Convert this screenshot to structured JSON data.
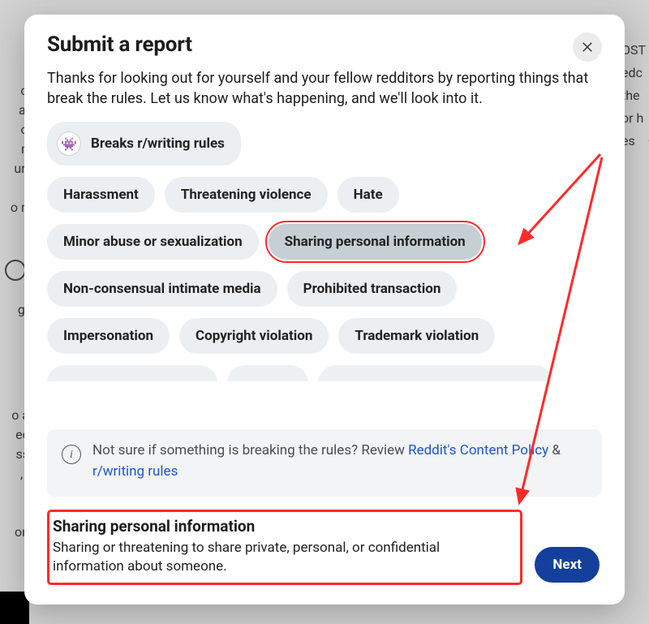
{
  "modal": {
    "title": "Submit a report",
    "intro": "Thanks for looking out for yourself and your fellow redditors by reporting things that break the rules. Let us know what's happening, and we'll look into it.",
    "community_rule_label": "Breaks r/writing rules",
    "reasons_row1": [
      "Harassment",
      "Threatening violence",
      "Hate"
    ],
    "reasons_row2": [
      "Minor abuse or sexualization",
      "Sharing personal information"
    ],
    "reasons_row3": [
      "Non-consensual intimate media",
      "Prohibited transaction"
    ],
    "reasons_row4": [
      "Impersonation",
      "Copyright violation",
      "Trademark violation"
    ],
    "selected_index": [
      1,
      1
    ],
    "policy_hint_prefix": "Not sure if something is breaking the rules? Review ",
    "policy_link1": "Reddit's Content Policy",
    "policy_and": " & ",
    "policy_link2": "r/writing rules",
    "selected_title": "Sharing personal information",
    "selected_description": "Sharing or threatening to share private, personal, or confidential information about someone.",
    "next_label": "Next"
  },
  "background": {
    "left_fragments": "of\nas\nor\nm\nura\nn\no m",
    "left_time": "go",
    "right_fragments": "OST\nedc\nthe\nor h\nes    •",
    "bottom_left": "o a\nec\nss\n, l\n\n\non"
  },
  "annotation": {
    "color": "#ff2a2a"
  }
}
